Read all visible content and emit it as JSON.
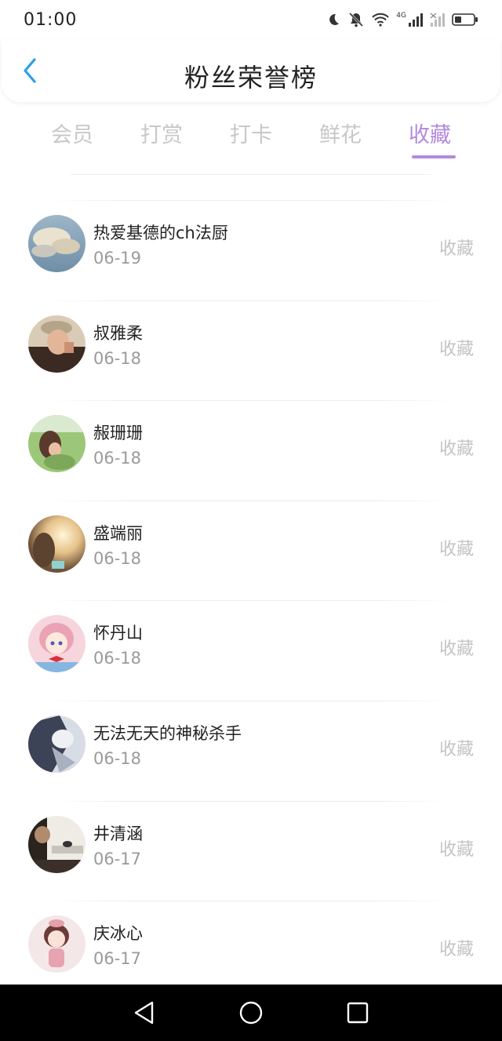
{
  "status": {
    "time": "01:00",
    "network_label": "4G",
    "battery_icon": "battery-icon"
  },
  "header": {
    "title": "粉丝荣誉榜",
    "back_icon": "chevron-left-icon"
  },
  "tabs": [
    {
      "label": "会员",
      "active": false
    },
    {
      "label": "打赏",
      "active": false
    },
    {
      "label": "打卡",
      "active": false
    },
    {
      "label": "鲜花",
      "active": false
    },
    {
      "label": "收藏",
      "active": true
    }
  ],
  "colors": {
    "accent": "#b389e0",
    "inactive_tab": "#c8c8c8",
    "date": "#9a9a9a",
    "action": "#c4c4c4"
  },
  "fans": [
    {
      "name": "热爱基德的ch法厨",
      "date": "06-19",
      "action": "收藏",
      "avatar": "sky-clouds-avatar"
    },
    {
      "name": "叔雅柔",
      "date": "06-18",
      "action": "收藏",
      "avatar": "man-cap-avatar"
    },
    {
      "name": "赧珊珊",
      "date": "06-18",
      "action": "收藏",
      "avatar": "girl-grass-avatar"
    },
    {
      "name": "盛端丽",
      "date": "06-18",
      "action": "收藏",
      "avatar": "sunlight-avatar"
    },
    {
      "name": "怀丹山",
      "date": "06-18",
      "action": "收藏",
      "avatar": "anime-girl-avatar"
    },
    {
      "name": "无法无天的神秘杀手",
      "date": "06-18",
      "action": "收藏",
      "avatar": "dark-figure-avatar"
    },
    {
      "name": "井清涵",
      "date": "06-17",
      "action": "收藏",
      "avatar": "room-avatar"
    },
    {
      "name": "庆冰心",
      "date": "06-17",
      "action": "收藏",
      "avatar": "cartoon-girl-avatar"
    }
  ]
}
